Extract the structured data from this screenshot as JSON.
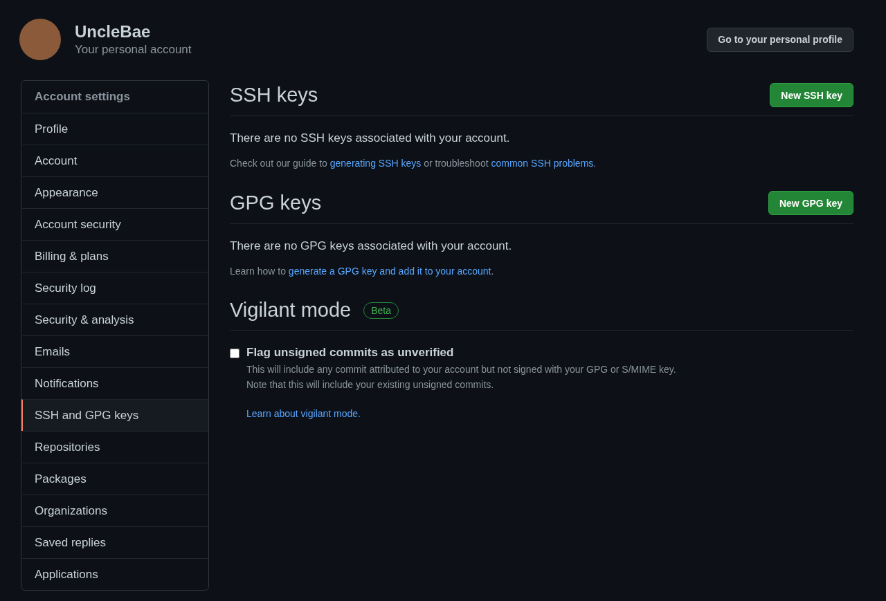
{
  "header": {
    "username": "UncleBae",
    "subtitle": "Your personal account",
    "profile_button": "Go to your personal profile"
  },
  "sidebar": {
    "title": "Account settings",
    "items": [
      {
        "label": "Profile",
        "selected": false
      },
      {
        "label": "Account",
        "selected": false
      },
      {
        "label": "Appearance",
        "selected": false
      },
      {
        "label": "Account security",
        "selected": false
      },
      {
        "label": "Billing & plans",
        "selected": false
      },
      {
        "label": "Security log",
        "selected": false
      },
      {
        "label": "Security & analysis",
        "selected": false
      },
      {
        "label": "Emails",
        "selected": false
      },
      {
        "label": "Notifications",
        "selected": false
      },
      {
        "label": "SSH and GPG keys",
        "selected": true
      },
      {
        "label": "Repositories",
        "selected": false
      },
      {
        "label": "Packages",
        "selected": false
      },
      {
        "label": "Organizations",
        "selected": false
      },
      {
        "label": "Saved replies",
        "selected": false
      },
      {
        "label": "Applications",
        "selected": false
      }
    ]
  },
  "sections": [
    {
      "title": "SSH keys",
      "button": "New SSH key",
      "message": "There are no SSH keys associated with your account.",
      "help": [
        {
          "text": "Check out our guide to ",
          "link": false
        },
        {
          "text": "generating SSH keys",
          "link": true
        },
        {
          "text": " or troubleshoot ",
          "link": false
        },
        {
          "text": "common SSH problems",
          "link": true
        },
        {
          "text": ".",
          "link": false
        }
      ]
    },
    {
      "title": "GPG keys",
      "button": "New GPG key",
      "message": "There are no GPG keys associated with your account.",
      "help": [
        {
          "text": "Learn how to ",
          "link": false
        },
        {
          "text": "generate a GPG key and add it to your account",
          "link": true
        },
        {
          "text": ".",
          "link": false
        }
      ]
    }
  ],
  "vigilant": {
    "title": "Vigilant mode",
    "badge": "Beta",
    "option": {
      "label": "Flag unsigned commits as unverified",
      "checked": false,
      "description": [
        "This will include any commit attributed to your account but not signed with your GPG or S/MIME key.",
        "Note that this will include your existing unsigned commits."
      ],
      "link": "Learn about vigilant mode."
    }
  }
}
